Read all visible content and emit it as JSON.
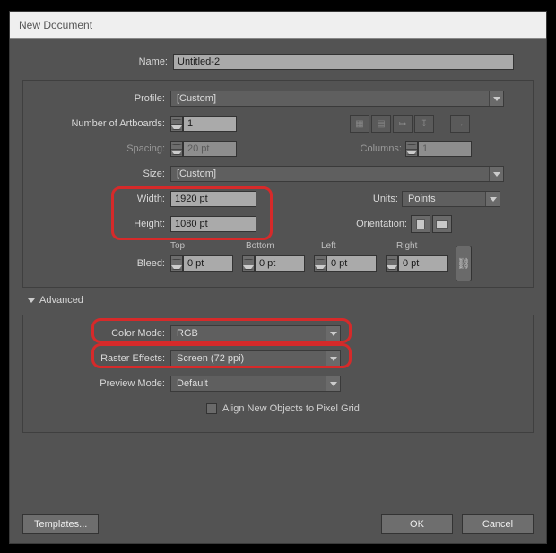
{
  "window": {
    "title": "New Document"
  },
  "name": {
    "label": "Name:",
    "value": "Untitled-2"
  },
  "profile": {
    "label": "Profile:",
    "value": "[Custom]"
  },
  "artboards": {
    "label": "Number of Artboards:",
    "value": "1"
  },
  "spacing": {
    "label": "Spacing:",
    "value": "20 pt"
  },
  "columns": {
    "label": "Columns:",
    "value": "1"
  },
  "size": {
    "label": "Size:",
    "value": "[Custom]"
  },
  "width": {
    "label": "Width:",
    "value": "1920 pt"
  },
  "height": {
    "label": "Height:",
    "value": "1080 pt"
  },
  "units": {
    "label": "Units:",
    "value": "Points"
  },
  "orientation": {
    "label": "Orientation:"
  },
  "bleed": {
    "label": "Bleed:",
    "top_label": "Top",
    "top": "0 pt",
    "bottom_label": "Bottom",
    "bottom": "0 pt",
    "left_label": "Left",
    "left": "0 pt",
    "right_label": "Right",
    "right": "0 pt"
  },
  "advanced": {
    "header": "Advanced",
    "color": {
      "label": "Color Mode:",
      "value": "RGB"
    },
    "raster": {
      "label": "Raster Effects:",
      "value": "Screen (72 ppi)"
    },
    "preview": {
      "label": "Preview Mode:",
      "value": "Default"
    },
    "align_label": "Align New Objects to Pixel Grid"
  },
  "buttons": {
    "templates": "Templates...",
    "ok": "OK",
    "cancel": "Cancel"
  }
}
